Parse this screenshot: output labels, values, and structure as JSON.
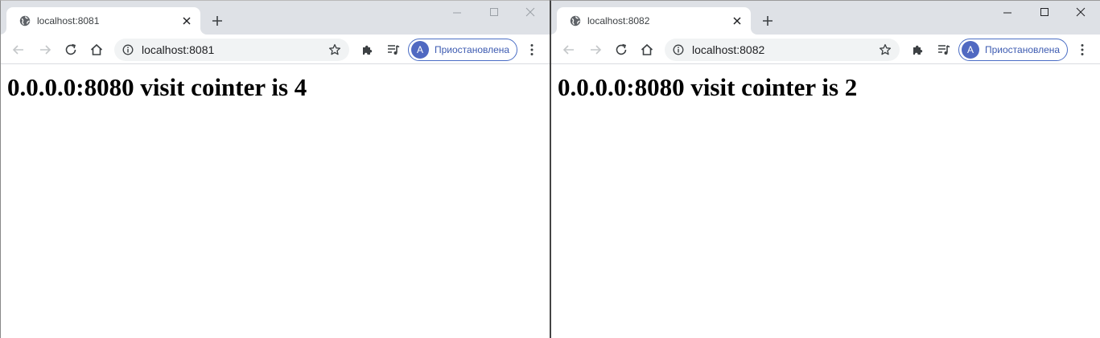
{
  "windows": [
    {
      "tab_title": "localhost:8081",
      "url": "localhost:8081",
      "profile_initial": "A",
      "profile_label": "Приостановлена",
      "heading": "0.0.0.0:8080 visit cointer is 4"
    },
    {
      "tab_title": "localhost:8082",
      "url": "localhost:8082",
      "profile_initial": "A",
      "profile_label": "Приостановлена",
      "heading": "0.0.0.0:8080 visit cointer is 2"
    }
  ],
  "icons": {
    "favicon": "globe-icon",
    "tab_close": "close-icon",
    "new_tab": "plus-icon",
    "back": "arrow-left-icon",
    "forward": "arrow-right-icon",
    "reload": "reload-icon",
    "home": "home-icon",
    "site_info": "info-icon",
    "bookmark": "star-icon",
    "extensions": "puzzle-icon",
    "media": "media-queue-icon",
    "menu": "kebab-menu-icon",
    "minimize": "minimize-icon",
    "maximize": "maximize-icon",
    "close_window": "close-window-icon"
  },
  "colors": {
    "titlebar_bg": "#dee1e6",
    "omnibox_bg": "#f1f3f4",
    "profile_accent": "#4b6ec5",
    "avatar_bg": "#5069c1"
  }
}
